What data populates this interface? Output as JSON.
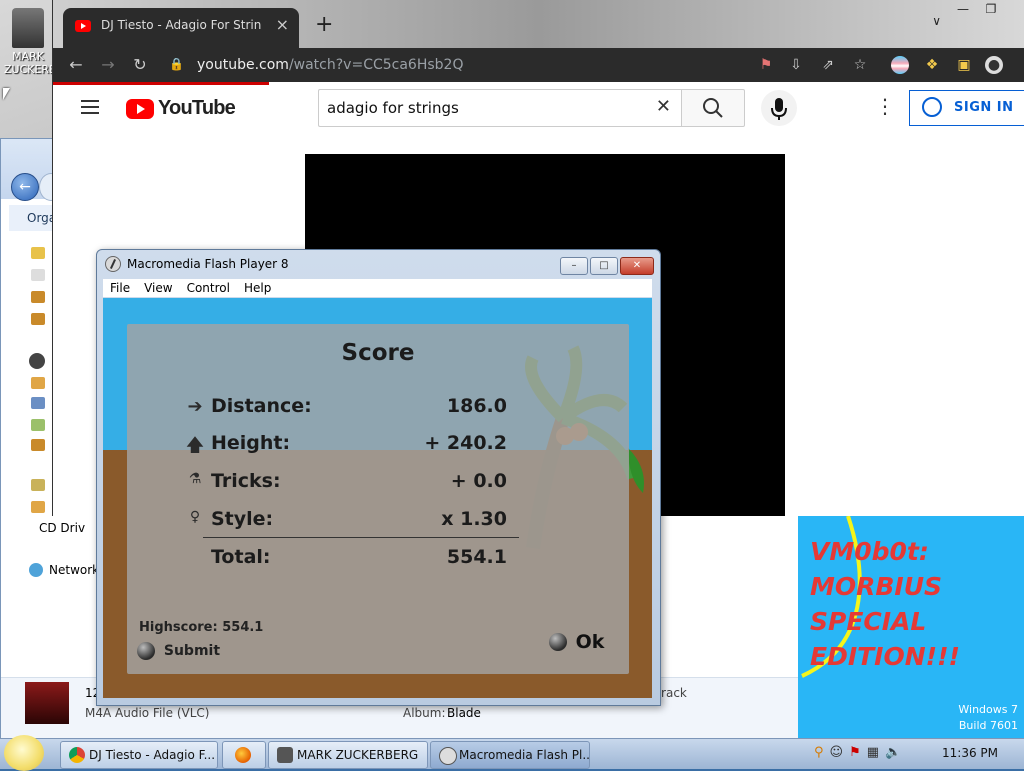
{
  "desktop": {
    "icon_label": "MARK ZUCKERBERG"
  },
  "chrome": {
    "tab_title": "DJ Tiesto - Adagio For Strings",
    "url_host": "youtube.com",
    "url_path": "/watch?v=CC5ca6Hsb2Q"
  },
  "youtube": {
    "logo": "YouTube",
    "search_value": "adagio for strings",
    "sign_in": "SIGN IN"
  },
  "flash": {
    "title": "Macromedia Flash Player 8",
    "menu": [
      "File",
      "View",
      "Control",
      "Help"
    ],
    "score": {
      "title": "Score",
      "rows": [
        {
          "label": "Distance:",
          "value": "186.0"
        },
        {
          "label": "Height:",
          "value": "+ 240.2"
        },
        {
          "label": "Tricks:",
          "value": "+ 0.0"
        },
        {
          "label": "Style:",
          "value": "x 1.30"
        },
        {
          "label": "Total:",
          "value": "554.1"
        }
      ],
      "highscore": "Highscore: 554.1",
      "submit": "Submit",
      "ok": "Ok"
    }
  },
  "explorer": {
    "organize": "Orga",
    "cd_drive": "CD Driv",
    "network": "Network",
    "file_number": "12",
    "file_type": "M4A Audio File (VLC)",
    "album_label": "Album:",
    "album_value": "Blade",
    "track_label": "ltrack"
  },
  "vmpanel": {
    "lines": [
      "VM0b0t:",
      "MORBIUS",
      "SPECIAL",
      "EDITION!!!"
    ],
    "os_name": "Windows 7",
    "os_build": "Build 7601"
  },
  "taskbar": {
    "items": [
      "DJ Tiesto - Adagio F...",
      "MARK ZUCKERBERG",
      "Macromedia Flash Pl..."
    ],
    "clock": "11:36 PM"
  }
}
